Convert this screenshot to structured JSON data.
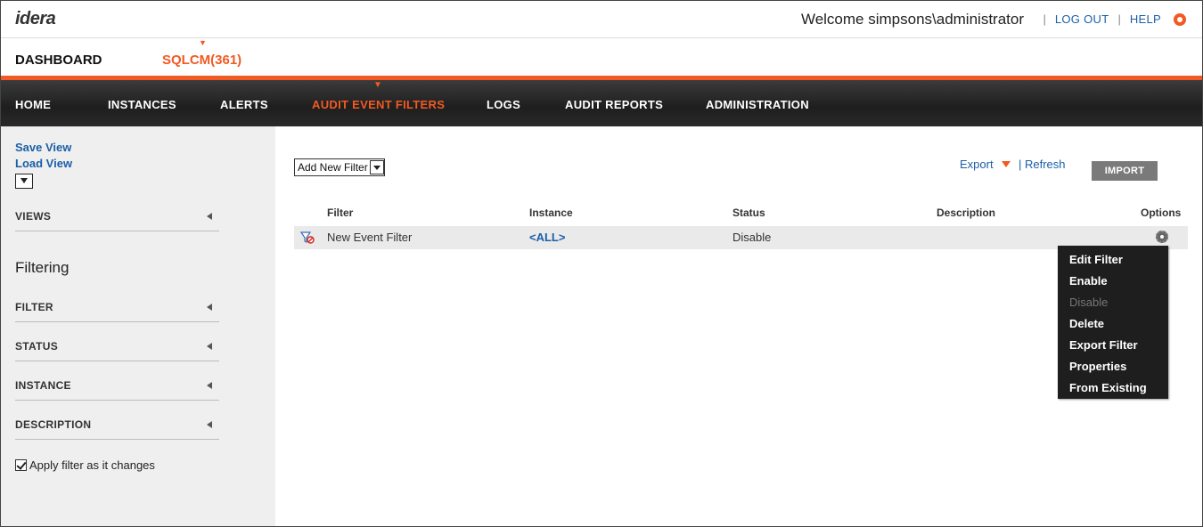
{
  "header": {
    "logo": "idera",
    "welcome": "Welcome simpsons\\administrator",
    "logout": "LOG OUT",
    "help": "HELP",
    "settings_icon": "gear-icon",
    "accent_color": "#f15a22"
  },
  "products": {
    "dashboard": "DASHBOARD",
    "sqlcm": "SQLCM(361)"
  },
  "nav": {
    "items": [
      "HOME",
      "INSTANCES",
      "ALERTS",
      "AUDIT EVENT FILTERS",
      "LOGS",
      "AUDIT REPORTS",
      "ADMINISTRATION"
    ],
    "active": "AUDIT EVENT FILTERS"
  },
  "sidebar": {
    "save_view": "Save View",
    "load_view": "Load View",
    "views": "VIEWS",
    "filtering_heading": "Filtering",
    "sections": [
      "FILTER",
      "STATUS",
      "INSTANCE",
      "DESCRIPTION"
    ],
    "apply_filter": "Apply filter as it changes",
    "apply_filter_checked": true
  },
  "main": {
    "add_filter": "Add New Filter",
    "export": "Export",
    "refresh": "| Refresh",
    "import": "IMPORT",
    "columns": [
      "Filter",
      "Instance",
      "Status",
      "Description",
      "Options"
    ],
    "rows": [
      {
        "filter": "New Event Filter",
        "instance": "<ALL>",
        "status": "Disable",
        "description": ""
      }
    ]
  },
  "context_menu": {
    "items": [
      {
        "label": "Edit Filter",
        "enabled": true
      },
      {
        "label": "Enable",
        "enabled": true
      },
      {
        "label": "Disable",
        "enabled": false
      },
      {
        "label": "Delete",
        "enabled": true
      },
      {
        "label": "Export Filter",
        "enabled": true
      },
      {
        "label": "Properties",
        "enabled": true
      },
      {
        "label": "From Existing",
        "enabled": true
      }
    ]
  }
}
